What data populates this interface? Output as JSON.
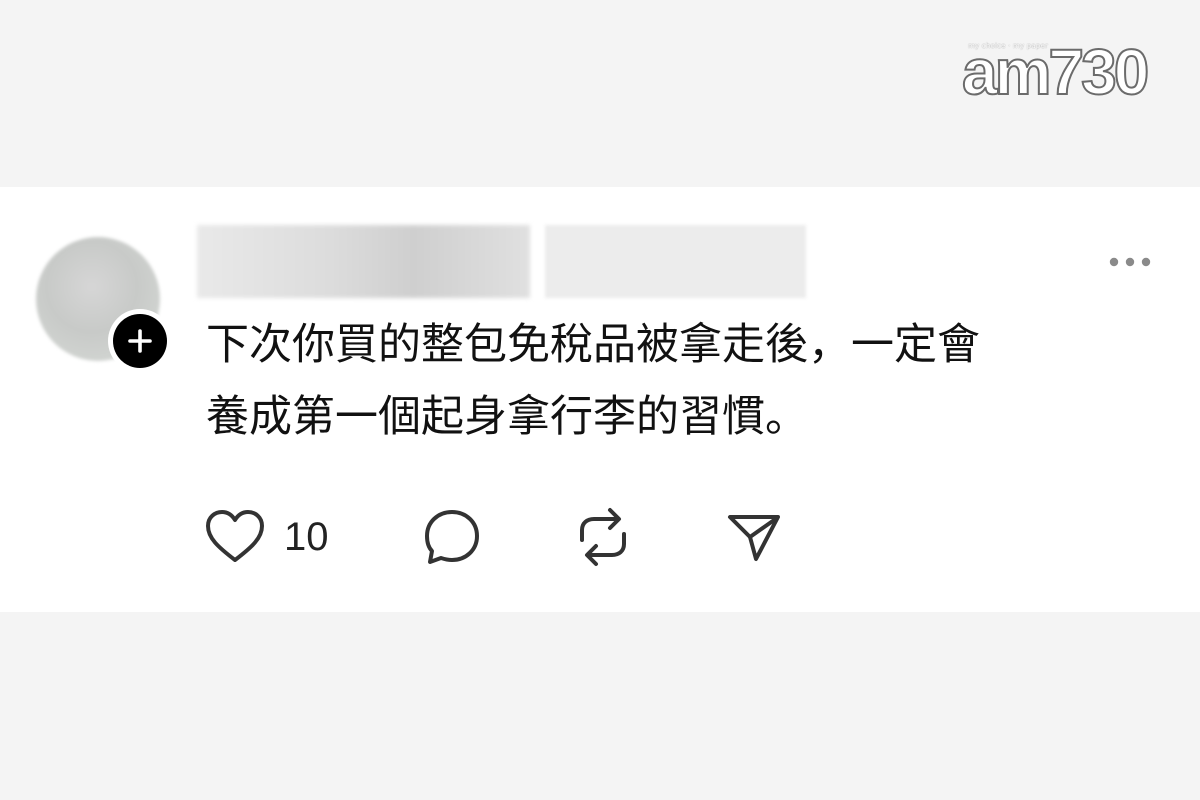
{
  "watermark": {
    "brand": "am730",
    "tagline": "my choice · my paper"
  },
  "post": {
    "text_lines": [
      "下次你買的整包免稅品被拿走後，一定會",
      "養成第一個起身拿行李的習慣。"
    ],
    "like_count": "10"
  },
  "icons": {
    "follow": "plus-icon",
    "more": "more-horizontal-icon",
    "like": "heart-icon",
    "reply": "comment-icon",
    "repost": "repost-icon",
    "share": "send-icon"
  },
  "colors": {
    "page_background": "#f4f4f4",
    "card_background": "#ffffff",
    "text": "#111111",
    "icon": "#333333",
    "more_dots": "#8a8a8a"
  }
}
